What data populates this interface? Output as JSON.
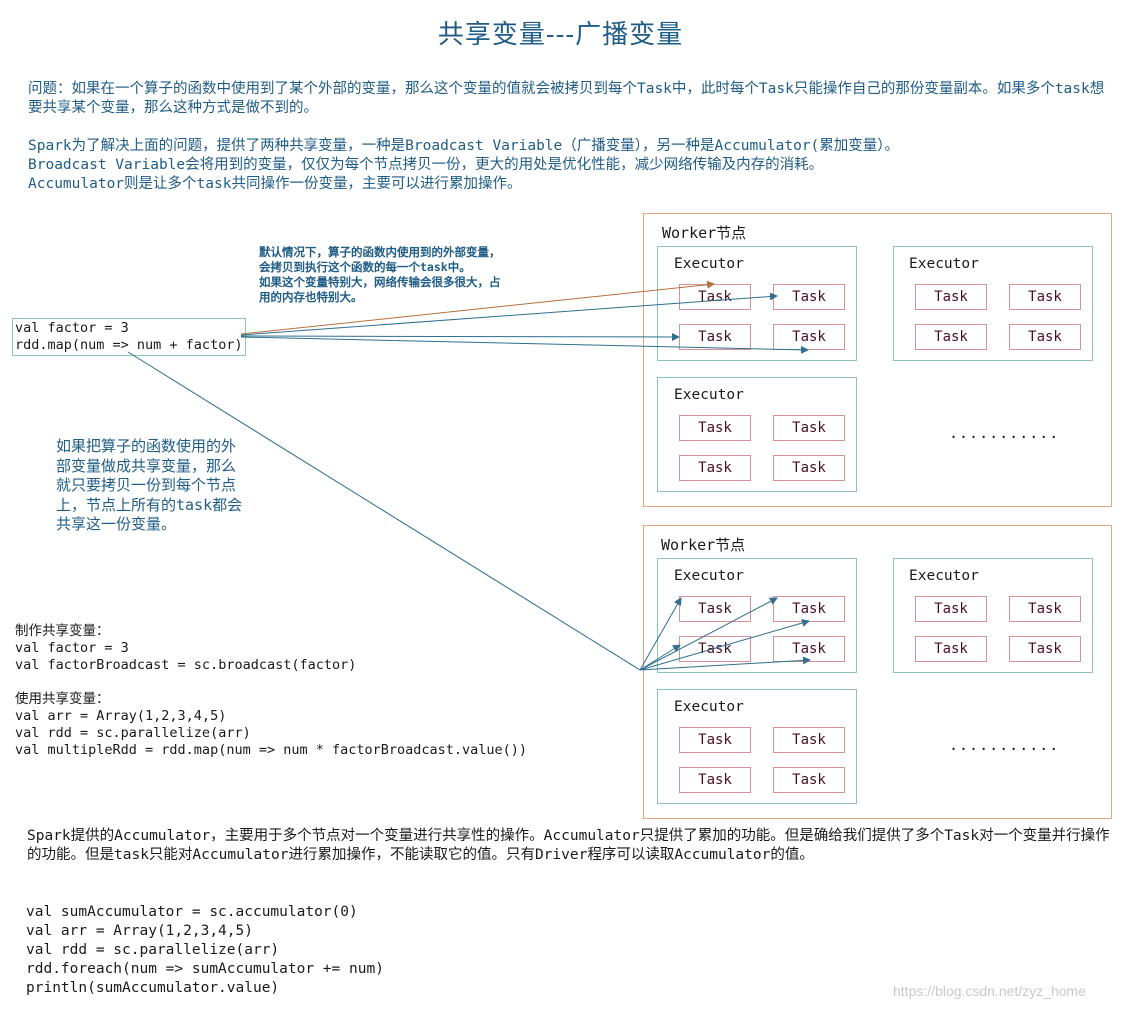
{
  "title": "共享变量---广播变量",
  "intro": {
    "problem": "问题：如果在一个算子的函数中使用到了某个外部的变量，那么这个变量的值就会被拷贝到每个Task中，此时每个Task只能操作自己的那份变量副本。如果多个task想要共享某个变量，那么这种方式是做不到的。",
    "solution_line1": "Spark为了解决上面的问题，提供了两种共享变量，一种是Broadcast Variable（广播变量），另一种是Accumulator(累加变量）。",
    "solution_line2": "Broadcast Variable会将用到的变量，仅仅为每个节点拷贝一份，更大的用处是优化性能，减少网络传输及内存的消耗。",
    "solution_line3": "Accumulator则是让多个task共同操作一份变量，主要可以进行累加操作。"
  },
  "default_note": "默认情况下，算子的函数内使用到的外部变量，\n会拷贝到执行这个函数的每一个task中。\n如果这个变量特别大，网络传输会很多很大，占\n用的内存也特别大。",
  "driver_code": "val factor = 3\nrdd.map(num => num + factor)",
  "broadcast_note": "如果把算子的函数使用的外\n部变量做成共享变量，那么\n就只要拷贝一份到每个节点\n上，节点上所有的task都会\n共享这一份变量。",
  "broadcast_code": "制作共享变量：\nval factor = 3\nval factorBroadcast = sc.broadcast(factor)\n\n使用共享变量：\nval arr = Array(1,2,3,4,5)\nval rdd = sc.parallelize(arr)\nval multipleRdd = rdd.map(num => num * factorBroadcast.value())",
  "workers": {
    "worker_label": "Worker节点",
    "executor_label": "Executor",
    "task_label": "Task",
    "ellipsis": "..........."
  },
  "accumulator": {
    "text": "Spark提供的Accumulator，主要用于多个节点对一个变量进行共享性的操作。Accumulator只提供了累加的功能。但是确给我们提供了多个Task对一个变量并行操作的功能。但是task只能对Accumulator进行累加操作，不能读取它的值。只有Driver程序可以读取Accumulator的值。",
    "code": "val sumAccumulator = sc.accumulator(0)\nval arr = Array(1,2,3,4,5)\nval rdd = sc.parallelize(arr)\nrdd.foreach(num => sumAccumulator += num)\nprintln(sumAccumulator.value)"
  },
  "watermark": "https://blog.csdn.net/zyz_home",
  "colors": {
    "title": "#1f5c86",
    "worker_border": "#e2a37f",
    "executor_border": "#8ec5b0",
    "task_border": "#d9909a",
    "arrow_blue": "#2f6f8f",
    "arrow_orange": "#b5703f"
  }
}
